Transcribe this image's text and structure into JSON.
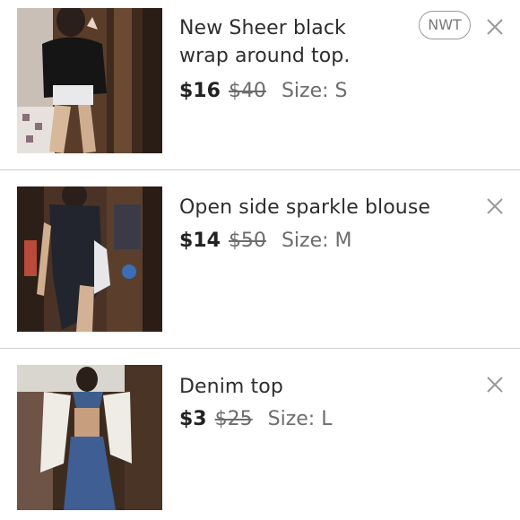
{
  "listings": [
    {
      "title": "New Sheer black wrap around top.",
      "title_line1": "New Sheer black",
      "title_line2": "wrap around top.",
      "price": "$16",
      "original_price": "$40",
      "size": "Size: S",
      "badge": "NWT",
      "remove_icon": "close-icon"
    },
    {
      "title": "Open side sparkle blouse",
      "price": "$14",
      "original_price": "$50",
      "size": "Size: M",
      "remove_icon": "close-icon"
    },
    {
      "title": "Denim top",
      "price": "$3",
      "original_price": "$25",
      "size": "Size: L",
      "remove_icon": "close-icon"
    }
  ],
  "colors": {
    "text": "#2e2e2e",
    "muted": "#6d6d6d",
    "divider": "#cfcfcf",
    "icon": "#9a9a9a"
  }
}
